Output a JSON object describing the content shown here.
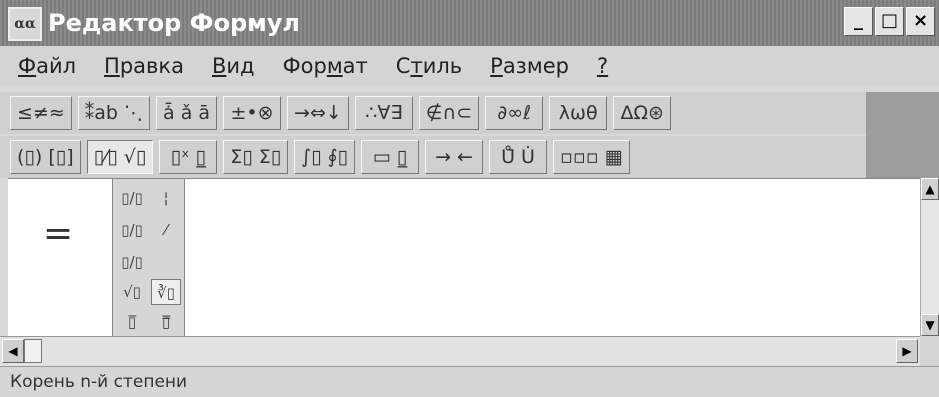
{
  "window": {
    "title": "Редактор Формул",
    "app_icon": "αα"
  },
  "window_controls": {
    "minimize": "_",
    "maximize": "□",
    "close": "×"
  },
  "menu": [
    {
      "label": "Файл",
      "accel": "Ф",
      "rest": "айл"
    },
    {
      "label": "Правка",
      "accel": "П",
      "rest": "равка"
    },
    {
      "label": "Вид",
      "accel": "В",
      "rest": "ид"
    },
    {
      "label": "Формат",
      "pre": "Фор",
      "accel": "м",
      "post": "ат"
    },
    {
      "label": "Стиль",
      "pre": "С",
      "accel": "т",
      "post": "иль"
    },
    {
      "label": "Размер",
      "accel": "Р",
      "rest": "азмер"
    },
    {
      "label": "?",
      "accel": "?",
      "rest": ""
    }
  ],
  "toolbar_row1": [
    {
      "glyphs": "≤≠≈",
      "name": "relations"
    },
    {
      "glyphs": "⁑ab ⋱",
      "name": "spaces-ellipses"
    },
    {
      "glyphs": "ǡ ǎ ā",
      "name": "embellishments"
    },
    {
      "glyphs": "±•⊗",
      "name": "operators"
    },
    {
      "glyphs": "→⇔↓",
      "name": "arrows"
    },
    {
      "glyphs": "∴∀∃",
      "name": "logic"
    },
    {
      "glyphs": "∉∩⊂",
      "name": "set-theory"
    },
    {
      "glyphs": "∂∞ℓ",
      "name": "misc-symbols"
    },
    {
      "glyphs": "λωθ",
      "name": "greek-lowercase"
    },
    {
      "glyphs": "ΔΩ⊛",
      "name": "greek-uppercase"
    }
  ],
  "toolbar_row2": [
    {
      "glyphs": "(▯) [▯]",
      "name": "fences"
    },
    {
      "glyphs": "▯⁄▯ √▯",
      "name": "fractions-radicals",
      "pressed": true
    },
    {
      "glyphs": "▯ˣ ▯̲",
      "name": "scripts"
    },
    {
      "glyphs": "Σ▯ Σ▯",
      "name": "summations"
    },
    {
      "glyphs": "∫▯ ∮▯",
      "name": "integrals"
    },
    {
      "glyphs": "▭ ▯̲",
      "name": "underbars-overbars"
    },
    {
      "glyphs": "→ ←",
      "name": "labeled-arrows"
    },
    {
      "glyphs": "Ů̄ U̇",
      "name": "products-set-theory"
    },
    {
      "glyphs": "▫▫▫ ▦",
      "name": "matrices"
    }
  ],
  "palette_items": [
    "▯/▯",
    "¦",
    "▯/▯",
    "⁄",
    "▯/▯",
    "",
    "√▯",
    "∛▯",
    "▯̅",
    "▯̿"
  ],
  "workspace": {
    "equation_symbol": "="
  },
  "status": {
    "text": "Корень n-й степени"
  },
  "colors": {
    "titlebar": "#808080",
    "face": "#d4d4d4",
    "workspace": "#ffffff"
  }
}
